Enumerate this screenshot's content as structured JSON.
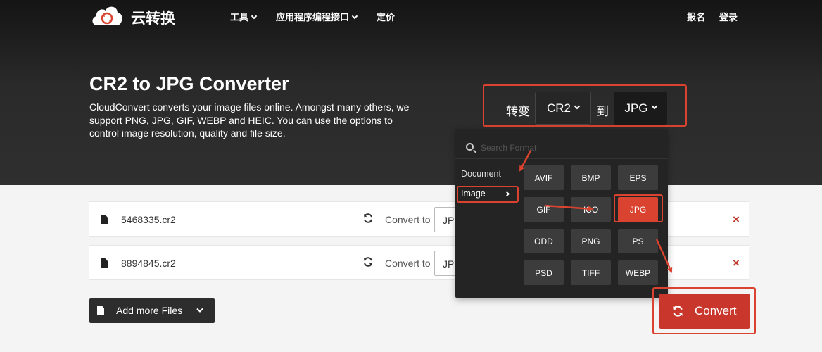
{
  "header": {
    "brand": "云转换",
    "nav": [
      {
        "label": "工具",
        "has_dropdown": true
      },
      {
        "label": "应用程序编程接口",
        "has_dropdown": true
      },
      {
        "label": "定价",
        "has_dropdown": false
      }
    ],
    "signup": "报名",
    "login": "登录"
  },
  "hero": {
    "title": "CR2 to JPG Converter",
    "description": "CloudConvert converts your image files online. Amongst many others, we support PNG, JPG, GIF, WEBP and HEIC. You can use the options to control image resolution, quality and file size."
  },
  "converter": {
    "convert_label": "转变",
    "from_format": "CR2",
    "to_label": "到",
    "to_format": "JPG"
  },
  "format_dropdown": {
    "search_placeholder": "Search Format",
    "categories": [
      {
        "label": "Document",
        "active": false
      },
      {
        "label": "Image",
        "active": true
      }
    ],
    "formats": [
      "AVIF",
      "BMP",
      "EPS",
      "GIF",
      "ICO",
      "JPG",
      "ODD",
      "PNG",
      "PS",
      "PSD",
      "TIFF",
      "WEBP"
    ],
    "selected": "JPG"
  },
  "files": [
    {
      "name": "5468335.cr2",
      "convert_to_label": "Convert to",
      "format": "JPG"
    },
    {
      "name": "8894845.cr2",
      "convert_to_label": "Convert to",
      "format": "JPG"
    }
  ],
  "actions": {
    "add_more": "Add more Files",
    "convert": "Convert",
    "remove_symbol": "×"
  },
  "colors": {
    "accent": "#d9432f",
    "convert_button": "#c9372c",
    "hero_bg": "#2a2a2a",
    "dropdown_bg": "#242424",
    "format_button": "#3c3c3c"
  }
}
